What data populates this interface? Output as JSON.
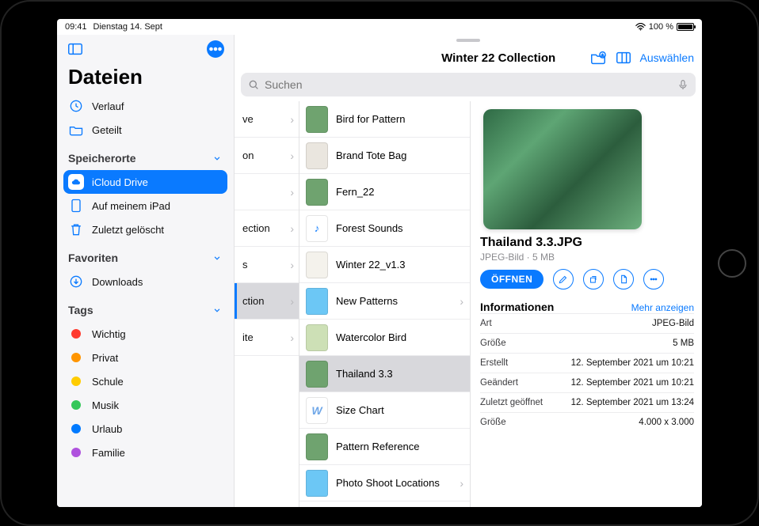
{
  "status": {
    "time": "09:41",
    "date": "Dienstag 14. Sept",
    "battery_pct": "100 %"
  },
  "sidebar": {
    "title": "Dateien",
    "recent": "Verlauf",
    "shared": "Geteilt",
    "sections": {
      "locations": "Speicherorte",
      "favorites": "Favoriten",
      "tags": "Tags"
    },
    "locations": {
      "icloud": "iCloud Drive",
      "onipad": "Auf meinem iPad",
      "trash": "Zuletzt gelöscht"
    },
    "favorites": {
      "downloads": "Downloads"
    },
    "tags": [
      {
        "label": "Wichtig",
        "color": "#ff3b30"
      },
      {
        "label": "Privat",
        "color": "#ff9500"
      },
      {
        "label": "Schule",
        "color": "#ffcc00"
      },
      {
        "label": "Musik",
        "color": "#34c759"
      },
      {
        "label": "Urlaub",
        "color": "#007aff"
      },
      {
        "label": "Familie",
        "color": "#af52de"
      }
    ]
  },
  "main": {
    "title": "Winter 22 Collection",
    "select": "Auswählen",
    "search_placeholder": "Suchen"
  },
  "col0": [
    {
      "label": "ve"
    },
    {
      "label": "on"
    },
    {
      "label": ""
    },
    {
      "label": "ection"
    },
    {
      "label": "s"
    },
    {
      "label": "ction",
      "selected": true
    },
    {
      "label": "ite"
    }
  ],
  "col1": [
    {
      "label": "Bird for Pattern",
      "kind": "img-green"
    },
    {
      "label": "Brand Tote Bag",
      "kind": "img-bag"
    },
    {
      "label": "Fern_22",
      "kind": "img-green"
    },
    {
      "label": "Forest Sounds",
      "kind": "audio"
    },
    {
      "label": "Winter 22_v1.3",
      "kind": "img-white"
    },
    {
      "label": "New Patterns",
      "kind": "folder",
      "chev": true
    },
    {
      "label": "Watercolor Bird",
      "kind": "img-bird"
    },
    {
      "label": "Thailand 3.3",
      "kind": "img-green",
      "selected": true
    },
    {
      "label": "Size Chart",
      "kind": "word"
    },
    {
      "label": "Pattern Reference",
      "kind": "img-green"
    },
    {
      "label": "Photo Shoot Locations",
      "kind": "folder",
      "chev": true
    }
  ],
  "detail": {
    "filename": "Thailand 3.3.JPG",
    "meta": "JPEG-Bild · 5 MB",
    "open": "ÖFFNEN",
    "info_header": "Informationen",
    "more": "Mehr anzeigen",
    "rows": [
      {
        "k": "Art",
        "v": "JPEG-Bild"
      },
      {
        "k": "Größe",
        "v": "5 MB"
      },
      {
        "k": "Erstellt",
        "v": "12. September 2021 um 10:21"
      },
      {
        "k": "Geändert",
        "v": "12. September 2021 um 10:21"
      },
      {
        "k": "Zuletzt geöffnet",
        "v": "12. September 2021 um 13:24"
      },
      {
        "k": "Größe",
        "v": "4.000 x 3.000"
      }
    ]
  }
}
